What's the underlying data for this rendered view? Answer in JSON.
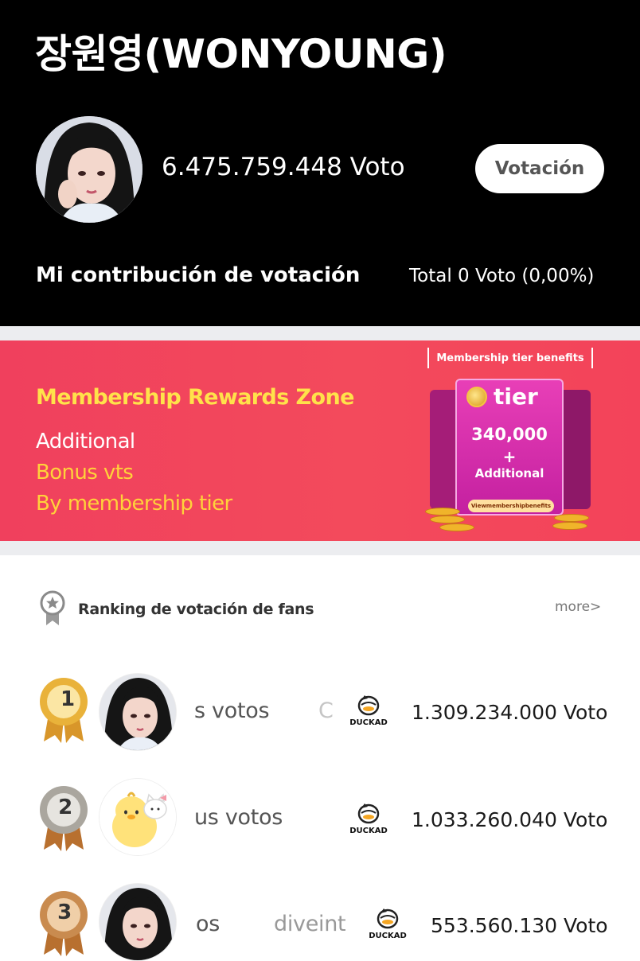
{
  "idol": {
    "title": "장원영(WONYOUNG)",
    "total_votes": "6.475.759.448 Voto",
    "vote_button": "Votación",
    "contribution_label": "Mi contribución de votación",
    "contribution_value": "Total 0 Voto (0,00%)"
  },
  "banner": {
    "title": "Membership Rewards Zone",
    "line1": "Additional",
    "line2": "Bonus vts",
    "line3": "By membership tier",
    "tag": "Membership tier benefits",
    "tier_word": "tier",
    "tier_amount": "340,000",
    "tier_plus": "+",
    "tier_additional": "Additional",
    "tier_benefit_button": "Viewmembershipbenefits",
    "colors": {
      "background": "#f0405d",
      "title": "#ffe24a",
      "text_white": "#ffffff",
      "text_yellow": "#ffd23a"
    }
  },
  "ranking": {
    "title": "Ranking de votación de fans",
    "more": "more>",
    "items": [
      {
        "rank": "1",
        "medal_color": "#e2a521",
        "name_visible": "s votos",
        "name_faded": "C",
        "ad_label": "DUCKAD",
        "votes": "1.309.234.000 Voto"
      },
      {
        "rank": "2",
        "medal_color": "#a7a39a",
        "name_visible": "us votos",
        "name_faded": "",
        "ad_label": "DUCKAD",
        "votes": "1.033.260.040 Voto"
      },
      {
        "rank": "3",
        "medal_color": "#c3884e",
        "name_visible": "os",
        "name_faded": "diveint",
        "ad_label": "DUCKAD",
        "votes": "553.560.130 Voto"
      }
    ]
  }
}
